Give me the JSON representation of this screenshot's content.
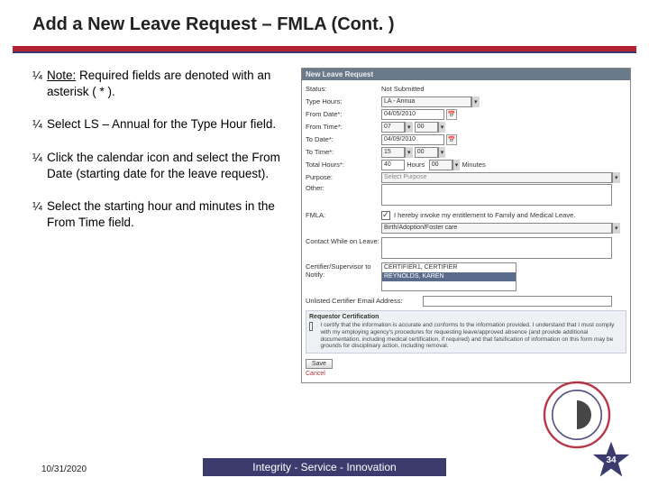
{
  "title": "Add a New Leave Request – FMLA (Cont. )",
  "bullets": [
    {
      "note_label": "Note:",
      "rest": "  Required fields are denoted with an asterisk ( * )."
    },
    {
      "text": "Select LS – Annual for the Type Hour field."
    },
    {
      "text": "Click the calendar icon and select the From Date (starting date for the leave request)."
    },
    {
      "text": "Select the starting hour and minutes in the From Time field."
    }
  ],
  "footer": {
    "date": "10/31/2020",
    "motto": "Integrity - Service - Innovation",
    "page": "34"
  },
  "form": {
    "panel_title": "New Leave Request",
    "status_label": "Status:",
    "status_value": "Not Submitted",
    "type_label": "Type Hours:",
    "type_value": "LA - Annua",
    "from_date_label": "From Date*:",
    "from_date_value": "04/05/2010",
    "from_time_label": "From Time*:",
    "from_hr": "07",
    "from_min": "00",
    "to_date_label": "To Date*:",
    "to_date_value": "04/09/2010",
    "to_time_label": "To Time*:",
    "to_hr": "15",
    "to_min": "00",
    "total_label": "Total Hours*:",
    "total_hr": "40",
    "hours_word": "Hours",
    "total_min": "00",
    "minutes_word": "Minutes",
    "purpose_label": "Purpose:",
    "purpose_placeholder": "Select Purpose",
    "other_label": "Other:",
    "fmla_label": "FMLA:",
    "fmla_check_text": "I hereby invoke my entitlement to Family and Medical Leave.",
    "fmla_select": "Birth/Adoption/Foster care",
    "contact_label": "Contact While on Leave:",
    "certifier_label": "Certifier/Supervisor to Notify:",
    "cert_opts": [
      "CERTIFIER1, CERTIFIER",
      "REYNOLDS, KAREN"
    ],
    "email_label": "Unlisted Certifier Email Address:",
    "cert_heading": "Requestor Certification",
    "cert_text": "I certify that the information is accurate and conforms to the information provided. I understand that I must comply with my employing agency's procedures for requesting leave/approved absence (and provide additional documentation, including medical certification, if required) and that falsification of information on this form may be grounds for disciplinary action, including removal.",
    "save_btn": "Save",
    "cancel_link": "Cancel"
  }
}
